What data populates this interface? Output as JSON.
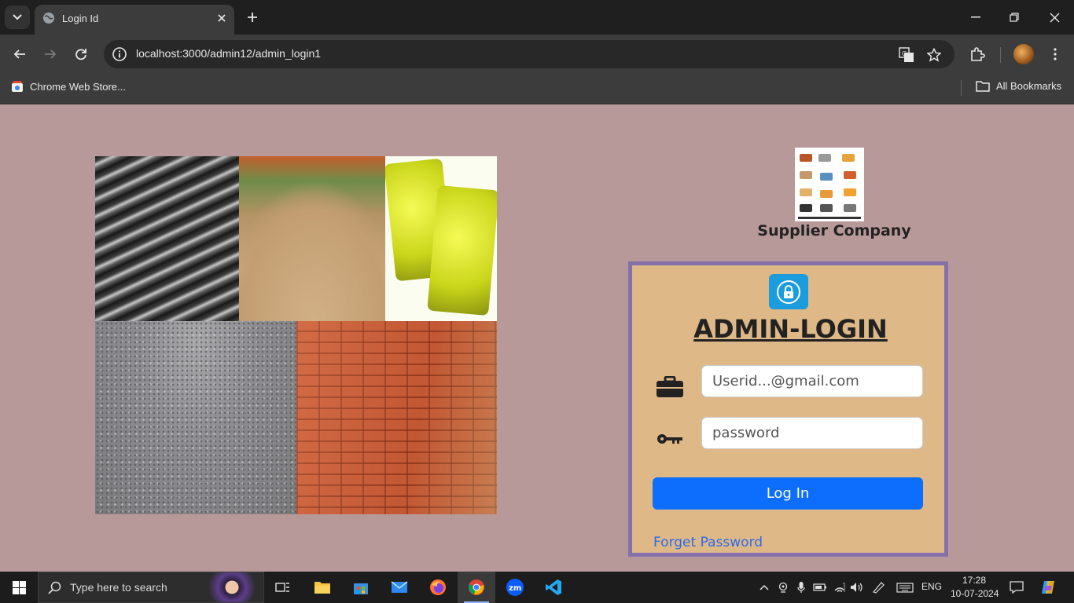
{
  "browser": {
    "tab_title": "Login Id",
    "url": "localhost:3000/admin12/admin_login1",
    "bookmarks": [
      {
        "label": "Chrome Web Store..."
      },
      {
        "label": "All Bookmarks"
      }
    ]
  },
  "page": {
    "company_name": "Supplier Company",
    "login_title": "ADMIN-LOGIN",
    "userid_placeholder": "Userid...@gmail.com",
    "password_placeholder": "password",
    "login_button": "Log In",
    "forget_password": "Forget Password"
  },
  "taskbar": {
    "search_placeholder": "Type here to search",
    "language": "ENG",
    "time": "17:28",
    "date": "10-07-2024"
  },
  "colors": {
    "page_bg": "#b89999",
    "card_bg": "#deb887",
    "card_border": "#8470ab",
    "button": "#0d6efd",
    "link": "#2f6ae8",
    "lock_icon_bg": "#1a9cdd"
  },
  "icons": [
    "tab-search-icon",
    "globe-icon",
    "close-icon",
    "plus-icon",
    "minimize-icon",
    "maximize-icon",
    "back-icon",
    "forward-icon",
    "reload-icon",
    "info-icon",
    "translate-icon",
    "star-icon",
    "extensions-icon",
    "menu-icon",
    "folder-icon",
    "lock-icon",
    "briefcase-icon",
    "key-icon",
    "windows-icon",
    "search-icon",
    "task-view-icon",
    "file-explorer-icon",
    "store-icon",
    "mail-icon",
    "firefox-icon",
    "chrome-icon",
    "zoom-icon",
    "vscode-icon"
  ]
}
